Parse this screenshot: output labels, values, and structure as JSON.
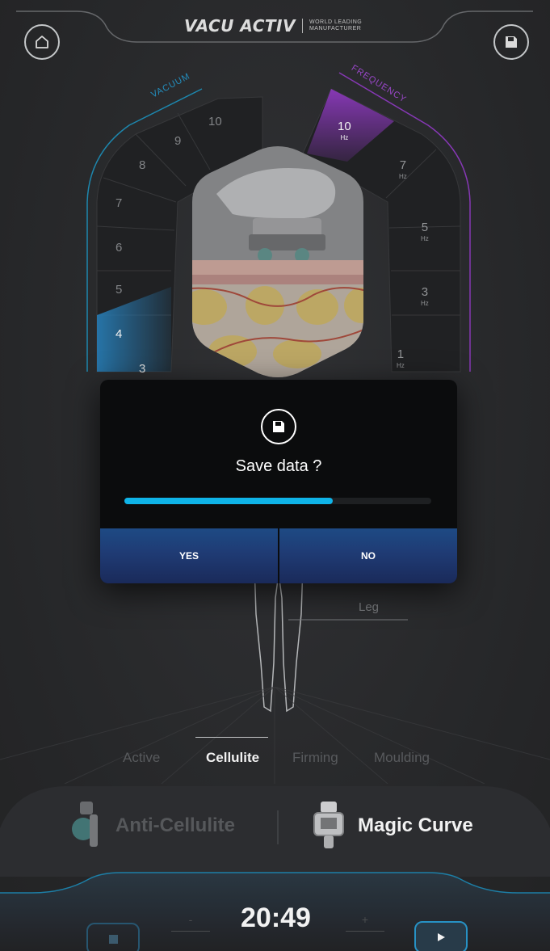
{
  "header": {
    "brand": "VACU ACTIV",
    "tagline_1": "WORLD LEADING",
    "tagline_2": "MANUFACTURER"
  },
  "vacuum": {
    "label": "VACUUM",
    "levels": [
      "10",
      "9",
      "8",
      "7",
      "6",
      "5",
      "4",
      "3"
    ],
    "selected": "4",
    "color": "#2a7fb8"
  },
  "frequency": {
    "label": "FREQUENCY",
    "values": [
      {
        "value": "10",
        "unit": "Hz"
      },
      {
        "value": "7",
        "unit": "Hz"
      },
      {
        "value": "5",
        "unit": "Hz"
      },
      {
        "value": "3",
        "unit": "Hz"
      },
      {
        "value": "1",
        "unit": "Hz"
      }
    ],
    "selected": "10",
    "color": "#7b2fa8"
  },
  "dialog": {
    "title": "Save data ?",
    "progress": 0.68,
    "yes_label": "YES",
    "no_label": "NO"
  },
  "body_zone": {
    "label": "Leg"
  },
  "modes": {
    "items": [
      "Active",
      "Cellulite",
      "Firming",
      "Moulding"
    ],
    "selected": "Cellulite"
  },
  "programs": {
    "left": "Anti-Cellulite",
    "right": "Magic Curve"
  },
  "timer": {
    "time": "20:49",
    "minus": "-",
    "plus": "+"
  },
  "icons": {
    "home": "home-icon",
    "save": "save-icon",
    "stop": "stop-icon",
    "play": "play-icon"
  },
  "colors": {
    "accent": "#00b4e6",
    "vacuum_arc": "#1f8fb8",
    "frequency_arc": "#8e3bbf"
  }
}
